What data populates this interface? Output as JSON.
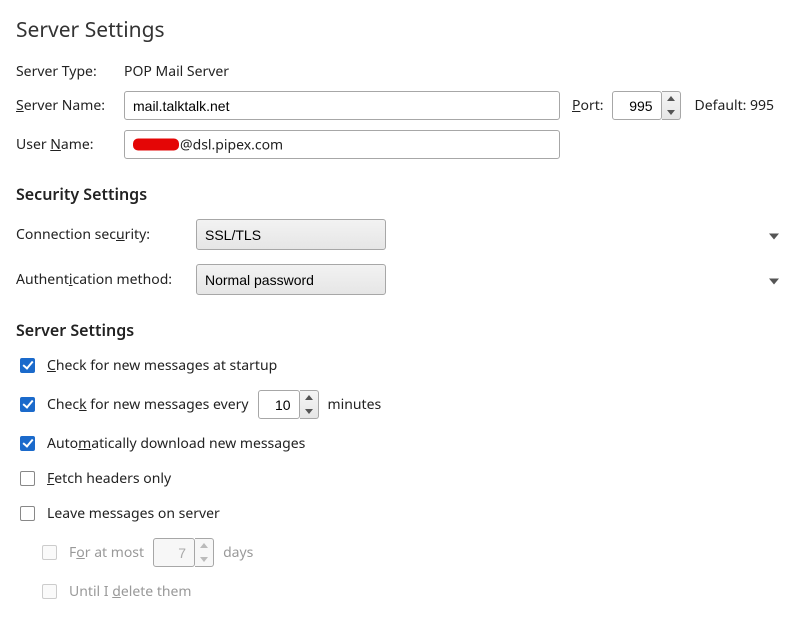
{
  "page_title": "Server Settings",
  "server_type_label": "Server Type:",
  "server_type_value": "POP Mail Server",
  "server_name_label_pre": "S",
  "server_name_label_post": "erver Name:",
  "server_name_value": "mail.talktalk.net",
  "port_label_pre": "P",
  "port_label_post": "ort:",
  "port_value": "995",
  "default_port_label": "Default: 995",
  "user_name_label_pre": "User ",
  "user_name_label_u": "N",
  "user_name_label_post": "ame:",
  "user_name_suffix": "@dsl.pipex.com",
  "security_heading": "Security Settings",
  "conn_sec_label_pre": "Connection sec",
  "conn_sec_label_u": "u",
  "conn_sec_label_post": "rity:",
  "conn_sec_value": "SSL/TLS",
  "auth_label_pre": "Authent",
  "auth_label_u": "i",
  "auth_label_post": "cation method:",
  "auth_value": "Normal password",
  "server_settings_heading": "Server Settings",
  "check_startup_pre": "C",
  "check_startup_post": "heck for new messages at startup",
  "check_startup_checked": true,
  "check_every_pre": "Chec",
  "check_every_u": "k",
  "check_every_mid": " for new messages every",
  "check_every_minutes": "10",
  "check_every_unit": "minutes",
  "check_every_checked": true,
  "auto_dl_pre": "Auto",
  "auto_dl_u": "m",
  "auto_dl_post": "atically download new messages",
  "auto_dl_checked": true,
  "fetch_headers_pre": "F",
  "fetch_headers_post": "etch headers only",
  "fetch_headers_checked": false,
  "leave_msgs_pre": "Leave messa",
  "leave_msgs_u": "g",
  "leave_msgs_post": "es on server",
  "leave_msgs_checked": false,
  "for_at_most_pre": "F",
  "for_at_most_u": "o",
  "for_at_most_mid": "r at most",
  "for_at_most_days": "7",
  "for_at_most_unit": "days",
  "until_delete_pre": "Until I ",
  "until_delete_u": "d",
  "until_delete_post": "elete them"
}
